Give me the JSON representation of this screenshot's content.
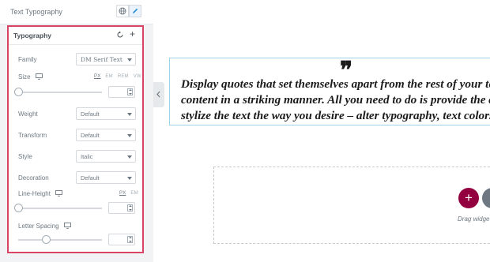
{
  "header": {
    "title": "Text Typography",
    "globe_icon": "globe-icon",
    "pen_icon": "pencil-icon"
  },
  "typography": {
    "title": "Typography",
    "reset_icon": "reset-icon",
    "add_icon": "+",
    "family": {
      "label": "Family",
      "value": "DM Serif Text"
    },
    "size": {
      "label": "Size",
      "units": [
        "PX",
        "EM",
        "REM",
        "VW"
      ],
      "active_unit": "PX",
      "value": ""
    },
    "weight": {
      "label": "Weight",
      "value": "Default"
    },
    "transform": {
      "label": "Transform",
      "value": "Default"
    },
    "style": {
      "label": "Style",
      "value": "Italic"
    },
    "decoration": {
      "label": "Decoration",
      "value": "Default"
    },
    "line_height": {
      "label": "Line-Height",
      "units": [
        "PX",
        "EM"
      ],
      "active_unit": "PX",
      "value": ""
    },
    "letter_spacing": {
      "label": "Letter Spacing",
      "value": ""
    }
  },
  "preview": {
    "quote_mark": "❞",
    "quote_lines": [
      "Display quotes that set themselves apart from the rest of your te",
      "content in a striking manner. All you need to do is provide the quo",
      "stylize the text the way you desire – alter typography, text colors"
    ],
    "add_button": "+",
    "drag_text": "Drag widge"
  },
  "colors": {
    "accent_border": "#d94464",
    "add_button_bg": "#93003f",
    "quote_box_border": "#9bd3e6"
  }
}
